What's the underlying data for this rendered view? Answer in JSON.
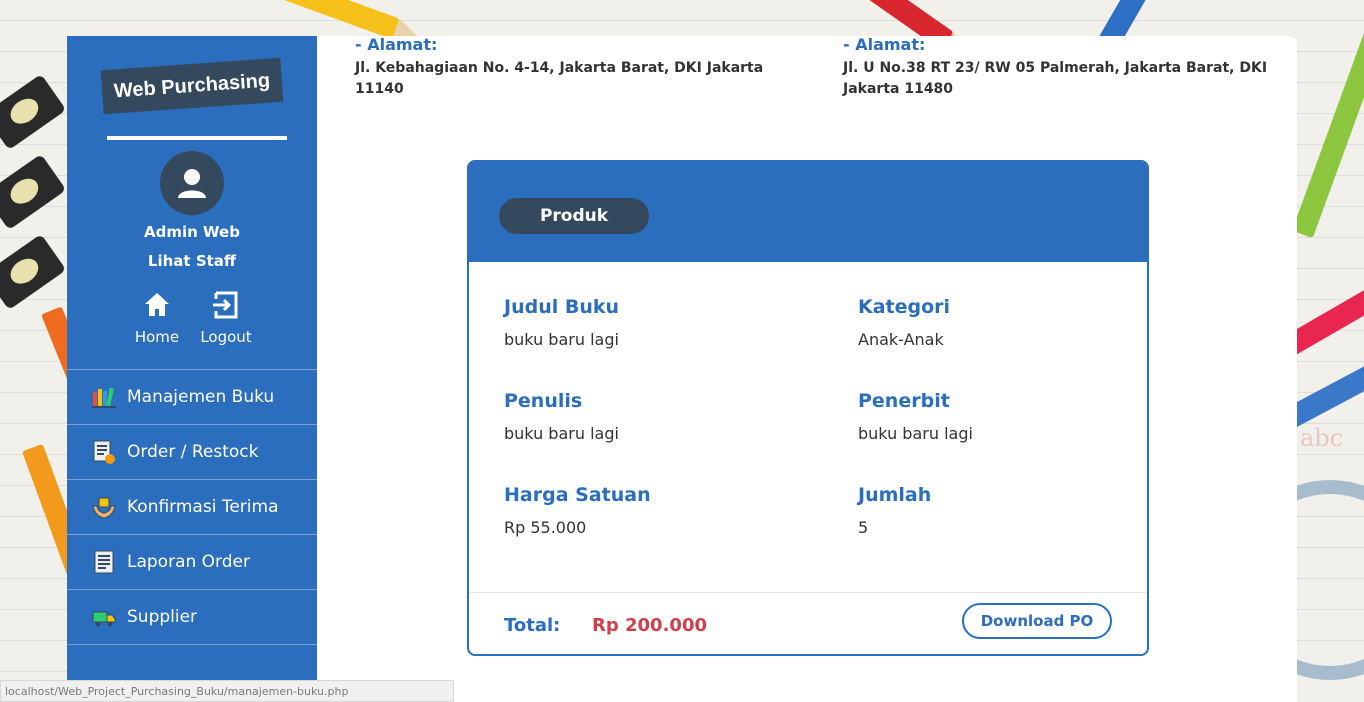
{
  "sidebar": {
    "brand": "Web Purchasing",
    "user_name": "Admin Web",
    "staff_link": "Lihat Staff",
    "home_label": "Home",
    "logout_label": "Logout",
    "menu": [
      {
        "label": "Manajemen Buku",
        "icon": "books-icon"
      },
      {
        "label": "Order / Restock",
        "icon": "order-list-icon"
      },
      {
        "label": "Konfirmasi Terima",
        "icon": "hands-receive-icon"
      },
      {
        "label": "Laporan Order",
        "icon": "report-icon"
      },
      {
        "label": "Supplier",
        "icon": "truck-icon"
      }
    ]
  },
  "addresses": [
    {
      "label": "- Alamat:",
      "text": "Jl. Kebahagiaan No. 4-14, Jakarta Barat, DKI Jakarta 11140"
    },
    {
      "label": "- Alamat:",
      "text": "Jl. U No.38 RT 23/ RW 05 Palmerah, Jakarta Barat, DKI Jakarta 11480"
    }
  ],
  "card": {
    "heading": "Produk",
    "fields": {
      "judul_label": "Judul Buku",
      "judul_value": "buku baru lagi",
      "kategori_label": "Kategori",
      "kategori_value": "Anak-Anak",
      "penulis_label": "Penulis",
      "penulis_value": "buku baru lagi",
      "penerbit_label": "Penerbit",
      "penerbit_value": "buku baru lagi",
      "harga_label": "Harga Satuan",
      "harga_value": "Rp 55.000",
      "jumlah_label": "Jumlah",
      "jumlah_value": "5"
    },
    "total_label": "Total:",
    "total_value": "Rp 200.000",
    "download_label": "Download PO"
  },
  "status_url": "localhost/Web_Project_Purchasing_Buku/manajemen-buku.php",
  "colors": {
    "primary": "#2a6ebd",
    "dark": "#34495e",
    "total": "#d23f4a"
  }
}
